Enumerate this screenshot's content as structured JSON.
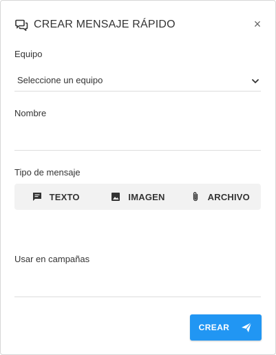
{
  "dialog": {
    "title": "CREAR MENSAJE RÁPIDO",
    "close_symbol": "×"
  },
  "form": {
    "team": {
      "label": "Equipo",
      "value": "Seleccione un equipo"
    },
    "name": {
      "label": "Nombre",
      "value": ""
    },
    "message_type": {
      "label": "Tipo de mensaje",
      "options": [
        {
          "label": "TEXTO",
          "icon": "message-icon"
        },
        {
          "label": "IMAGEN",
          "icon": "image-icon"
        },
        {
          "label": "ARCHIVO",
          "icon": "paperclip-icon"
        }
      ]
    },
    "campaigns": {
      "label": "Usar en campañas",
      "value": ""
    }
  },
  "actions": {
    "submit_label": "CREAR"
  },
  "colors": {
    "accent": "#2196f3",
    "toggle_bg": "#f2f2f2",
    "divider": "#dcdcdc"
  }
}
